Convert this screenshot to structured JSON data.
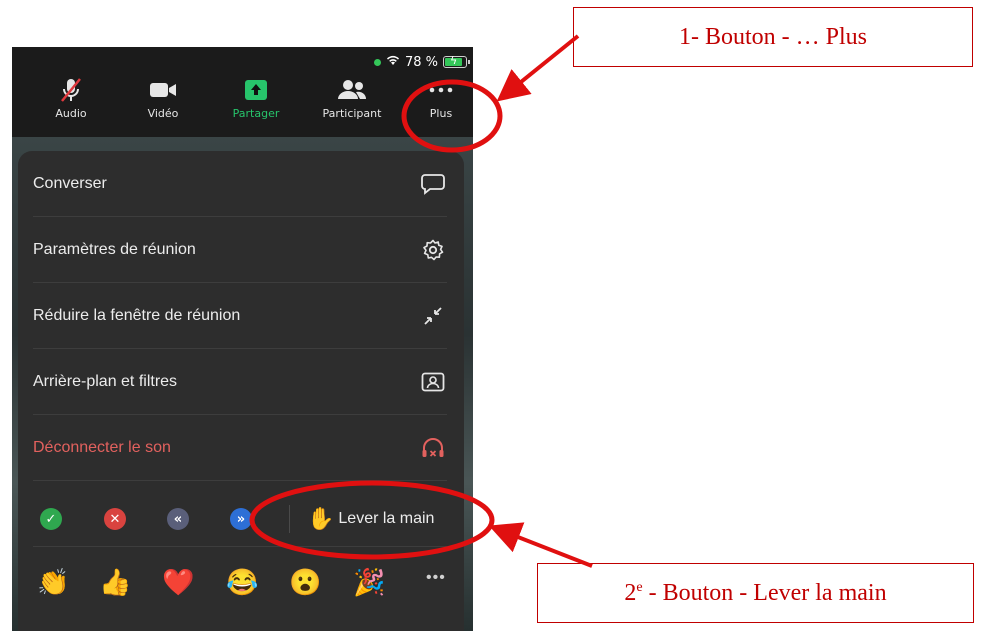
{
  "status": {
    "battery": "78 %"
  },
  "toolbar": {
    "audio": "Audio",
    "video": "Vidéo",
    "share": "Partager",
    "participants": "Participant",
    "more": "Plus"
  },
  "menu": {
    "items": [
      {
        "label": "Converser",
        "icon": "chat-bubble-icon"
      },
      {
        "label": "Paramètres de réunion",
        "icon": "gear-icon"
      },
      {
        "label": "Réduire la fenêtre de réunion",
        "icon": "minimize-arrows-icon"
      },
      {
        "label": "Arrière-plan et filtres",
        "icon": "background-portrait-icon"
      },
      {
        "label": "Déconnecter le son",
        "icon": "headphones-off-icon"
      }
    ],
    "raise_hand": "Lever la main",
    "more_dots": "•••"
  },
  "annotations": {
    "callout1": "1- Bouton - … Plus",
    "callout2_prefix": "2",
    "callout2_sup": "e",
    "callout2_rest": " - Bouton - Lever la main"
  },
  "colors": {
    "accent_red": "#c00000",
    "share_green": "#27c46b",
    "danger_text": "#e2615e"
  }
}
